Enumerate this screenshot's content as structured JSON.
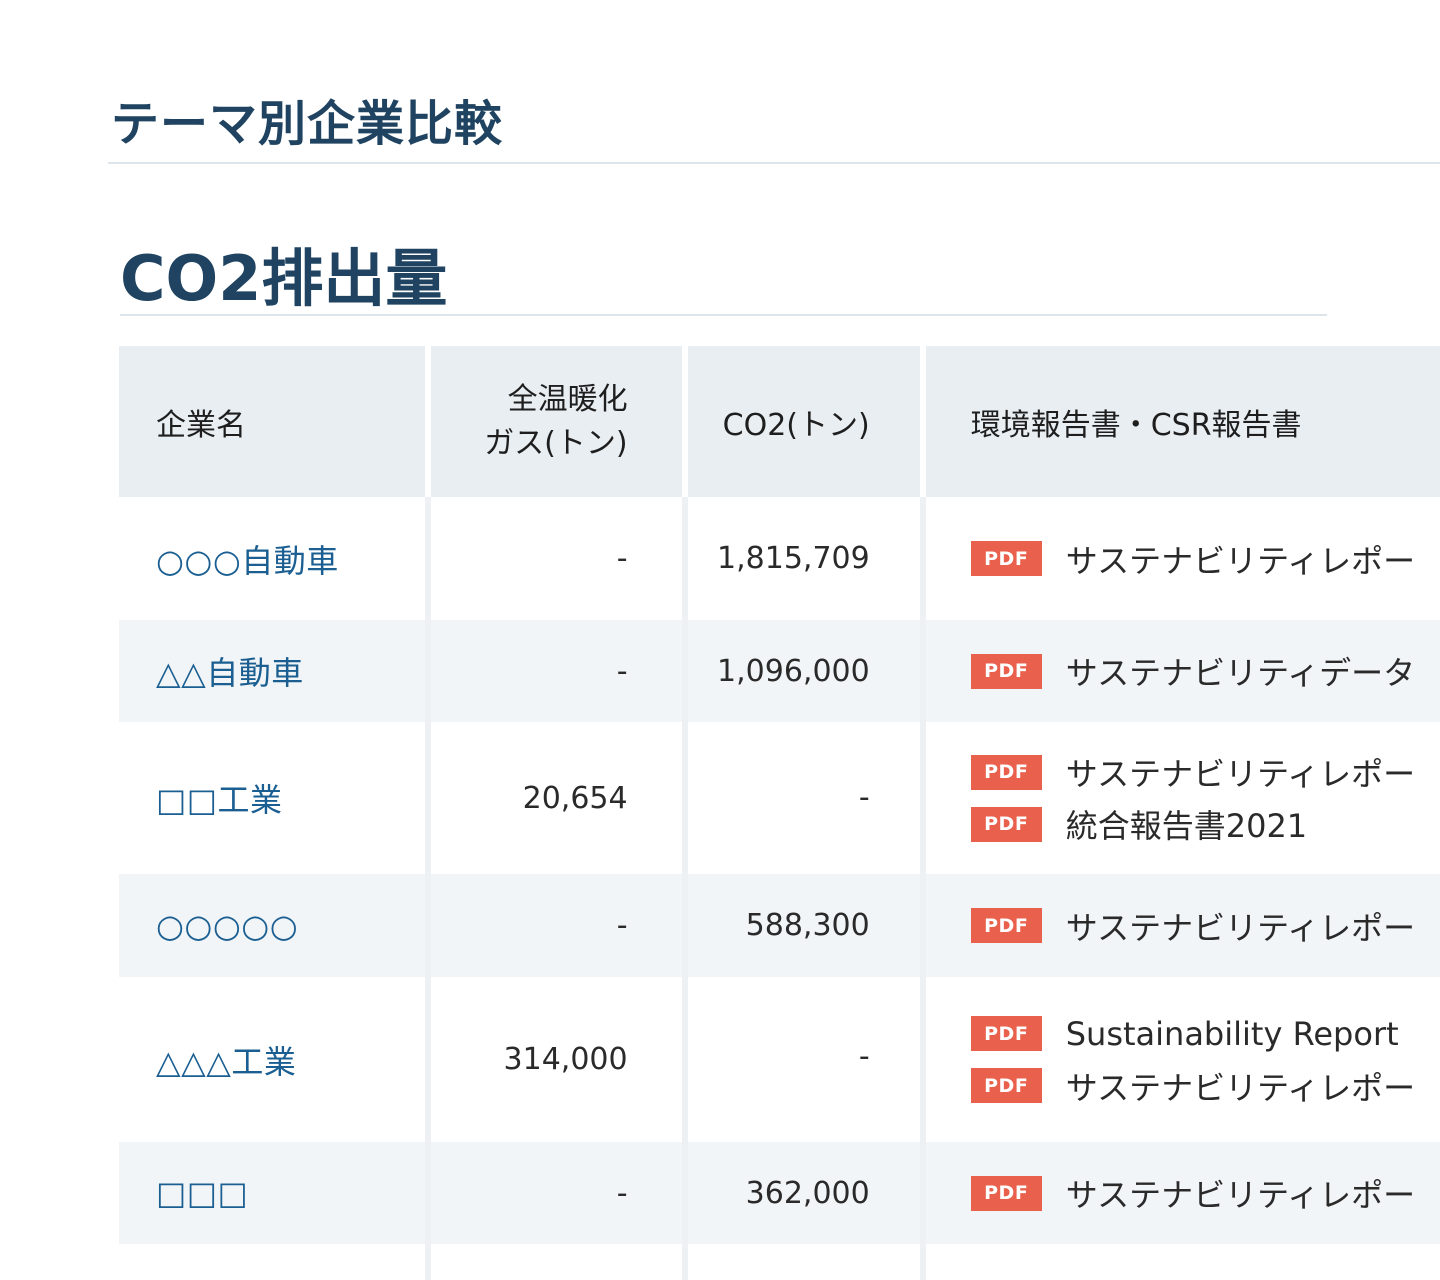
{
  "page": {
    "title": "テーマ別企業比較",
    "section_title": "CO2排出量"
  },
  "table": {
    "headers": {
      "company": "企業名",
      "ghg_line1": "全温暖化",
      "ghg_line2": "ガス(トン)",
      "co2": "CO2(トン)",
      "reports": "環境報告書・CSR報告書"
    },
    "rows": [
      {
        "company": "○○○自動車",
        "ghg": "-",
        "co2": "1,815,709",
        "docs": [
          {
            "badge": "PDF",
            "label": "サステナビリティレポー"
          }
        ]
      },
      {
        "company": "△△自動車",
        "ghg": "-",
        "co2": "1,096,000",
        "docs": [
          {
            "badge": "PDF",
            "label": "サステナビリティデータ"
          }
        ]
      },
      {
        "company": "□□工業",
        "ghg": "20,654",
        "co2": "-",
        "docs": [
          {
            "badge": "PDF",
            "label": "サステナビリティレポー"
          },
          {
            "badge": "PDF",
            "label": "統合報告書2021"
          }
        ]
      },
      {
        "company": "○○○○○",
        "ghg": "-",
        "co2": "588,300",
        "docs": [
          {
            "badge": "PDF",
            "label": "サステナビリティレポー"
          }
        ]
      },
      {
        "company": "△△△工業",
        "ghg": "314,000",
        "co2": "-",
        "docs": [
          {
            "badge": "PDF",
            "label": "Sustainability Report"
          },
          {
            "badge": "PDF",
            "label": "サステナビリティレポー"
          }
        ]
      },
      {
        "company": "□□□",
        "ghg": "-",
        "co2": "362,000",
        "docs": [
          {
            "badge": "PDF",
            "label": "サステナビリティレポー"
          }
        ]
      }
    ]
  },
  "colors": {
    "title": "#1f4360",
    "link": "#1b5f92",
    "pdf_badge": "#e9614d",
    "header_bg": "#e8eef2",
    "shade_row_bg": "#f2f5f7"
  }
}
